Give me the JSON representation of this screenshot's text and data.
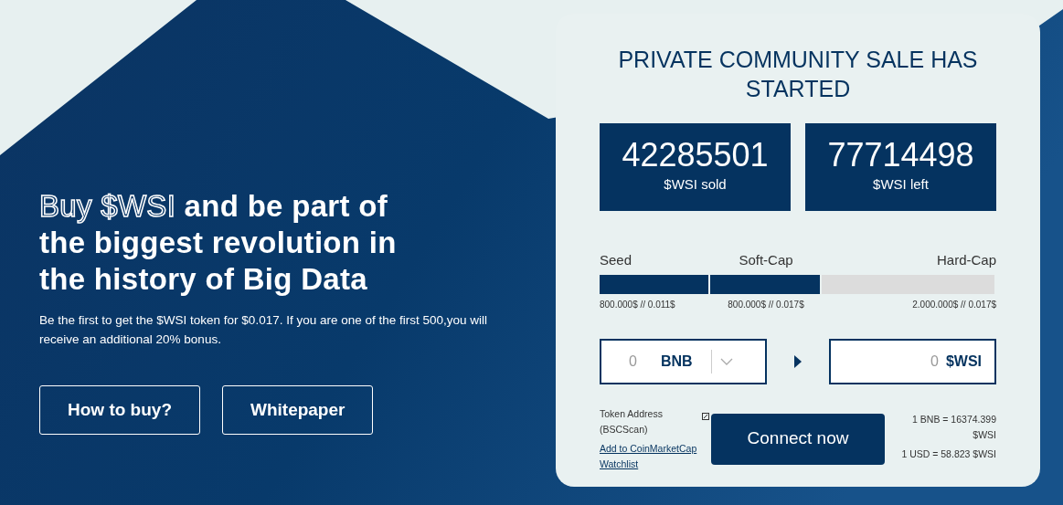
{
  "hero": {
    "headline_outlined": "Buy $WSI",
    "headline_rest": "and be part of the biggest revolution in the history of Big Data",
    "subtext": "Be the first to get the $WSI token for $0.017. If you are one of the first 500,you will receive an additional 20% bonus.",
    "buttons": [
      "How to buy?",
      "Whitepaper"
    ]
  },
  "sale": {
    "title": "PRIVATE COMMUNITY SALE HAS STARTED",
    "stats": [
      {
        "value": "42285501",
        "label": "$WSI sold"
      },
      {
        "value": "77714498",
        "label": "$WSI left"
      }
    ],
    "stages": [
      {
        "name": "Seed",
        "caption": "800.000$ // 0.011$",
        "level": 1
      },
      {
        "name": "Soft-Cap",
        "caption": "800.000$ // 0.017$",
        "level": 1
      },
      {
        "name": "Hard-Cap",
        "caption": "2.000.000$ // 0.017$",
        "level": 0
      }
    ],
    "pay": {
      "amount": "0",
      "currency": "BNB"
    },
    "receive": {
      "amount": "0",
      "currency": "$WSI"
    },
    "token_address": "Token Address (BSCScan)",
    "watchlist_link": "Add to CoinMarketCap Watchlist",
    "connect_button": "Connect now",
    "rates": [
      "1 BNB = 16374.399 $WSI",
      "1 USD = 58.823 $WSI"
    ]
  }
}
